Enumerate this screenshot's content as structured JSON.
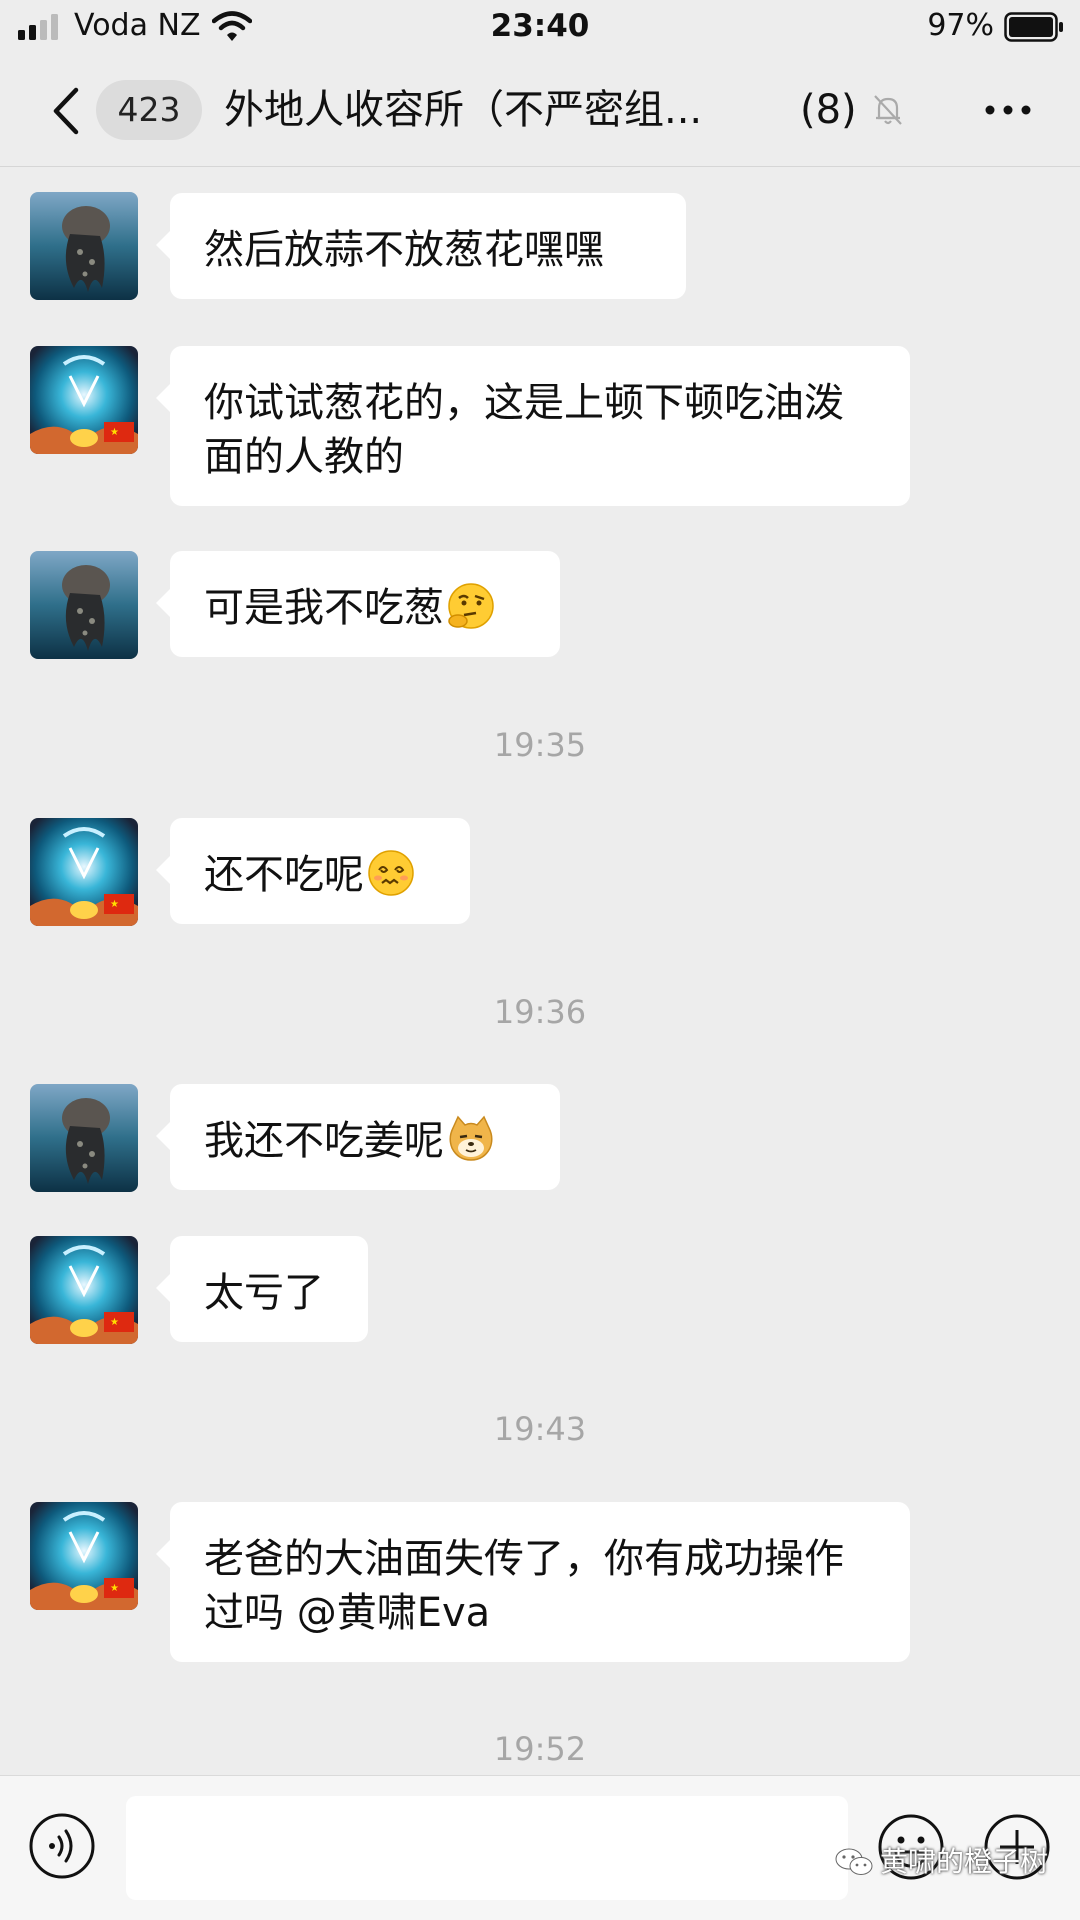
{
  "status_bar": {
    "carrier": "Voda NZ",
    "time": "23:40",
    "battery_percent": "97%"
  },
  "nav": {
    "unread_count": "423",
    "title": "外地人收容所（不严密组...",
    "member_count": "(8)"
  },
  "messages": [
    {
      "sender": "jellyfish-avatar",
      "text": "然后放蒜不放葱花嘿嘿",
      "emoji": ""
    },
    {
      "sender": "mandala-avatar",
      "text": "你试试葱花的，这是上顿下顿吃油泼面的人教的",
      "emoji": ""
    },
    {
      "sender": "jellyfish-avatar",
      "text": "可是我不吃葱",
      "emoji": "thinking-emoji"
    },
    {
      "sender": "mandala-avatar",
      "text": "还不吃呢",
      "emoji": "dizzy-emoji"
    },
    {
      "sender": "jellyfish-avatar",
      "text": "我还不吃姜呢",
      "emoji": "doge-emoji"
    },
    {
      "sender": "mandala-avatar",
      "text": "太亏了",
      "emoji": ""
    },
    {
      "sender": "mandala-avatar",
      "text": "老爸的大油面失传了，你有成功操作过吗 @黄啸Eva",
      "emoji": ""
    }
  ],
  "timestamps": [
    "19:35",
    "19:36",
    "19:43",
    "19:52"
  ],
  "input": {
    "value": "",
    "placeholder": ""
  },
  "watermark": "黄啸的橙子树",
  "colors": {
    "background": "#ededed",
    "bubble": "#ffffff",
    "timestamp": "#a6a6a6"
  }
}
